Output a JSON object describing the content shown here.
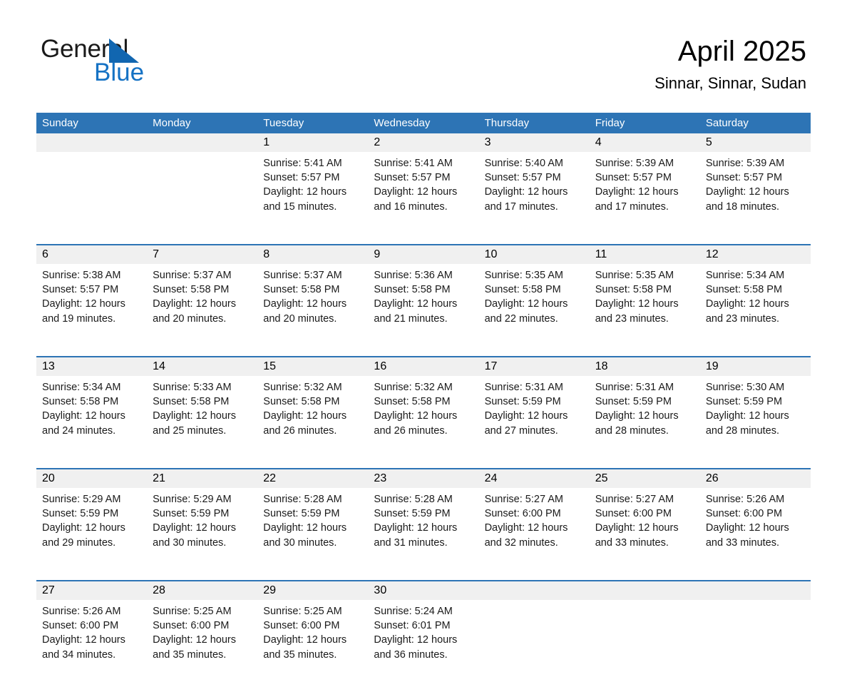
{
  "logo": {
    "word_one": "General",
    "word_two": "Blue",
    "triangle_color": "#1166b0",
    "blue_color": "#1572c4"
  },
  "header": {
    "title": "April 2025",
    "subtitle": "Sinnar, Sinnar, Sudan",
    "accent_color": "#2d74b5",
    "daynum_bg": "#f0f0f0"
  },
  "weekdays": [
    "Sunday",
    "Monday",
    "Tuesday",
    "Wednesday",
    "Thursday",
    "Friday",
    "Saturday"
  ],
  "weeks": [
    [
      {
        "day": "",
        "sunrise": "",
        "sunset": "",
        "daylight": ""
      },
      {
        "day": "",
        "sunrise": "",
        "sunset": "",
        "daylight": ""
      },
      {
        "day": "1",
        "sunrise": "Sunrise: 5:41 AM",
        "sunset": "Sunset: 5:57 PM",
        "daylight": "Daylight: 12 hours and 15 minutes."
      },
      {
        "day": "2",
        "sunrise": "Sunrise: 5:41 AM",
        "sunset": "Sunset: 5:57 PM",
        "daylight": "Daylight: 12 hours and 16 minutes."
      },
      {
        "day": "3",
        "sunrise": "Sunrise: 5:40 AM",
        "sunset": "Sunset: 5:57 PM",
        "daylight": "Daylight: 12 hours and 17 minutes."
      },
      {
        "day": "4",
        "sunrise": "Sunrise: 5:39 AM",
        "sunset": "Sunset: 5:57 PM",
        "daylight": "Daylight: 12 hours and 17 minutes."
      },
      {
        "day": "5",
        "sunrise": "Sunrise: 5:39 AM",
        "sunset": "Sunset: 5:57 PM",
        "daylight": "Daylight: 12 hours and 18 minutes."
      }
    ],
    [
      {
        "day": "6",
        "sunrise": "Sunrise: 5:38 AM",
        "sunset": "Sunset: 5:57 PM",
        "daylight": "Daylight: 12 hours and 19 minutes."
      },
      {
        "day": "7",
        "sunrise": "Sunrise: 5:37 AM",
        "sunset": "Sunset: 5:58 PM",
        "daylight": "Daylight: 12 hours and 20 minutes."
      },
      {
        "day": "8",
        "sunrise": "Sunrise: 5:37 AM",
        "sunset": "Sunset: 5:58 PM",
        "daylight": "Daylight: 12 hours and 20 minutes."
      },
      {
        "day": "9",
        "sunrise": "Sunrise: 5:36 AM",
        "sunset": "Sunset: 5:58 PM",
        "daylight": "Daylight: 12 hours and 21 minutes."
      },
      {
        "day": "10",
        "sunrise": "Sunrise: 5:35 AM",
        "sunset": "Sunset: 5:58 PM",
        "daylight": "Daylight: 12 hours and 22 minutes."
      },
      {
        "day": "11",
        "sunrise": "Sunrise: 5:35 AM",
        "sunset": "Sunset: 5:58 PM",
        "daylight": "Daylight: 12 hours and 23 minutes."
      },
      {
        "day": "12",
        "sunrise": "Sunrise: 5:34 AM",
        "sunset": "Sunset: 5:58 PM",
        "daylight": "Daylight: 12 hours and 23 minutes."
      }
    ],
    [
      {
        "day": "13",
        "sunrise": "Sunrise: 5:34 AM",
        "sunset": "Sunset: 5:58 PM",
        "daylight": "Daylight: 12 hours and 24 minutes."
      },
      {
        "day": "14",
        "sunrise": "Sunrise: 5:33 AM",
        "sunset": "Sunset: 5:58 PM",
        "daylight": "Daylight: 12 hours and 25 minutes."
      },
      {
        "day": "15",
        "sunrise": "Sunrise: 5:32 AM",
        "sunset": "Sunset: 5:58 PM",
        "daylight": "Daylight: 12 hours and 26 minutes."
      },
      {
        "day": "16",
        "sunrise": "Sunrise: 5:32 AM",
        "sunset": "Sunset: 5:58 PM",
        "daylight": "Daylight: 12 hours and 26 minutes."
      },
      {
        "day": "17",
        "sunrise": "Sunrise: 5:31 AM",
        "sunset": "Sunset: 5:59 PM",
        "daylight": "Daylight: 12 hours and 27 minutes."
      },
      {
        "day": "18",
        "sunrise": "Sunrise: 5:31 AM",
        "sunset": "Sunset: 5:59 PM",
        "daylight": "Daylight: 12 hours and 28 minutes."
      },
      {
        "day": "19",
        "sunrise": "Sunrise: 5:30 AM",
        "sunset": "Sunset: 5:59 PM",
        "daylight": "Daylight: 12 hours and 28 minutes."
      }
    ],
    [
      {
        "day": "20",
        "sunrise": "Sunrise: 5:29 AM",
        "sunset": "Sunset: 5:59 PM",
        "daylight": "Daylight: 12 hours and 29 minutes."
      },
      {
        "day": "21",
        "sunrise": "Sunrise: 5:29 AM",
        "sunset": "Sunset: 5:59 PM",
        "daylight": "Daylight: 12 hours and 30 minutes."
      },
      {
        "day": "22",
        "sunrise": "Sunrise: 5:28 AM",
        "sunset": "Sunset: 5:59 PM",
        "daylight": "Daylight: 12 hours and 30 minutes."
      },
      {
        "day": "23",
        "sunrise": "Sunrise: 5:28 AM",
        "sunset": "Sunset: 5:59 PM",
        "daylight": "Daylight: 12 hours and 31 minutes."
      },
      {
        "day": "24",
        "sunrise": "Sunrise: 5:27 AM",
        "sunset": "Sunset: 6:00 PM",
        "daylight": "Daylight: 12 hours and 32 minutes."
      },
      {
        "day": "25",
        "sunrise": "Sunrise: 5:27 AM",
        "sunset": "Sunset: 6:00 PM",
        "daylight": "Daylight: 12 hours and 33 minutes."
      },
      {
        "day": "26",
        "sunrise": "Sunrise: 5:26 AM",
        "sunset": "Sunset: 6:00 PM",
        "daylight": "Daylight: 12 hours and 33 minutes."
      }
    ],
    [
      {
        "day": "27",
        "sunrise": "Sunrise: 5:26 AM",
        "sunset": "Sunset: 6:00 PM",
        "daylight": "Daylight: 12 hours and 34 minutes."
      },
      {
        "day": "28",
        "sunrise": "Sunrise: 5:25 AM",
        "sunset": "Sunset: 6:00 PM",
        "daylight": "Daylight: 12 hours and 35 minutes."
      },
      {
        "day": "29",
        "sunrise": "Sunrise: 5:25 AM",
        "sunset": "Sunset: 6:00 PM",
        "daylight": "Daylight: 12 hours and 35 minutes."
      },
      {
        "day": "30",
        "sunrise": "Sunrise: 5:24 AM",
        "sunset": "Sunset: 6:01 PM",
        "daylight": "Daylight: 12 hours and 36 minutes."
      },
      {
        "day": "",
        "sunrise": "",
        "sunset": "",
        "daylight": ""
      },
      {
        "day": "",
        "sunrise": "",
        "sunset": "",
        "daylight": ""
      },
      {
        "day": "",
        "sunrise": "",
        "sunset": "",
        "daylight": ""
      }
    ]
  ]
}
